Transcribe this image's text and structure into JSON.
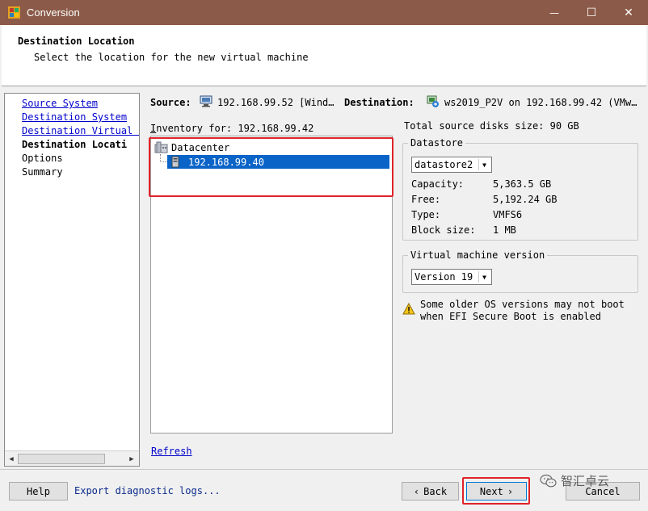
{
  "window": {
    "title": "Conversion",
    "minimize_glyph": "—",
    "maximize_glyph": "☐",
    "close_glyph": "✕",
    "titlebar_color": "#8b5a48"
  },
  "header": {
    "title": "Destination Location",
    "subtitle": "Select the location for the new virtual machine"
  },
  "nav": {
    "items": [
      {
        "label": "Source System",
        "type": "link"
      },
      {
        "label": "Destination System",
        "type": "link"
      },
      {
        "label": "Destination Virtual M",
        "type": "link"
      },
      {
        "label": "Destination Locati",
        "type": "current"
      },
      {
        "label": "Options",
        "type": "plain"
      },
      {
        "label": "Summary",
        "type": "plain"
      }
    ],
    "scroll_left": "◀",
    "scroll_right": "▶"
  },
  "summary_line": {
    "source_label": "Source:",
    "source_value": "192.168.99.52 [Wind…",
    "destination_label": "Destination:",
    "destination_value": "ws2019_P2V on 192.168.99.42 (VMw…"
  },
  "inventory": {
    "label_accel": "I",
    "label_rest": "nventory for:",
    "host": "192.168.99.42",
    "tree": [
      {
        "label": "Datacenter",
        "icon": "datacenter-icon",
        "level": 0
      },
      {
        "label": "192.168.99.40",
        "icon": "host-icon",
        "level": 1,
        "selected": true
      }
    ],
    "refresh_label": "Refresh"
  },
  "disk_info": {
    "total_label": "Total source disks size:",
    "total_value": "90 GB"
  },
  "datastore": {
    "legend": "Datastore",
    "selected": "datastore2",
    "fields": [
      {
        "label": "Capacity:",
        "value": "5,363.5 GB"
      },
      {
        "label": "Free:",
        "value": "5,192.24 GB"
      },
      {
        "label": "Type:",
        "value": "VMFS6"
      },
      {
        "label": "Block size:",
        "value": "1 MB"
      }
    ]
  },
  "vm_version": {
    "legend": "Virtual machine version",
    "selected": "Version 19"
  },
  "warning": {
    "line1": "Some older OS versions may not boot",
    "line2": "when EFI Secure Boot is enabled",
    "icon": "warning-icon"
  },
  "footer": {
    "help_label": "Help",
    "export_label": "Export diagnostic logs...",
    "back_label": "Back",
    "back_glyph": "‹",
    "next_label": "Next",
    "next_glyph": "›",
    "cancel_label": "Cancel"
  },
  "watermark": {
    "text": "智汇卓云"
  },
  "colors": {
    "selection": "#0a64c8",
    "link": "#0000cc",
    "highlight_box": "#e0232a"
  }
}
